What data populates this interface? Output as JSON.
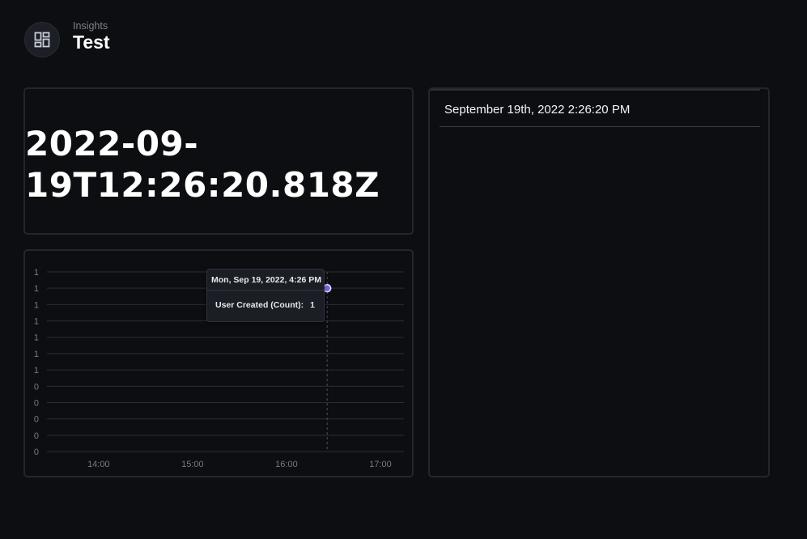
{
  "header": {
    "subtitle": "Insights",
    "title": "Test",
    "icon": "dashboard-icon"
  },
  "panels": {
    "big_value": "2022-09-19T12:26:20.818Z",
    "right_heading": "September 19th, 2022 2:26:20 PM"
  },
  "tooltip": {
    "title": "Mon, Sep 19, 2022, 4:26 PM",
    "label": "User Created (Count):",
    "value": "1"
  },
  "colors": {
    "background": "#0c0e12",
    "panel_border": "#22262d",
    "point": "#7c6cf0"
  },
  "chart_data": {
    "type": "line",
    "title": "",
    "xlabel": "",
    "ylabel": "",
    "x_ticks": [
      "14:00",
      "15:00",
      "16:00",
      "17:00"
    ],
    "y_ticks": [
      "1",
      "1",
      "1",
      "1",
      "1",
      "1",
      "1",
      "0",
      "0",
      "0",
      "0",
      "0"
    ],
    "xlim": [
      "13:27",
      "17:15"
    ],
    "ylim": [
      0,
      1.1
    ],
    "grid": true,
    "series": [
      {
        "name": "User Created (Count)",
        "x": [
          "16:26"
        ],
        "y": [
          1
        ]
      }
    ]
  }
}
